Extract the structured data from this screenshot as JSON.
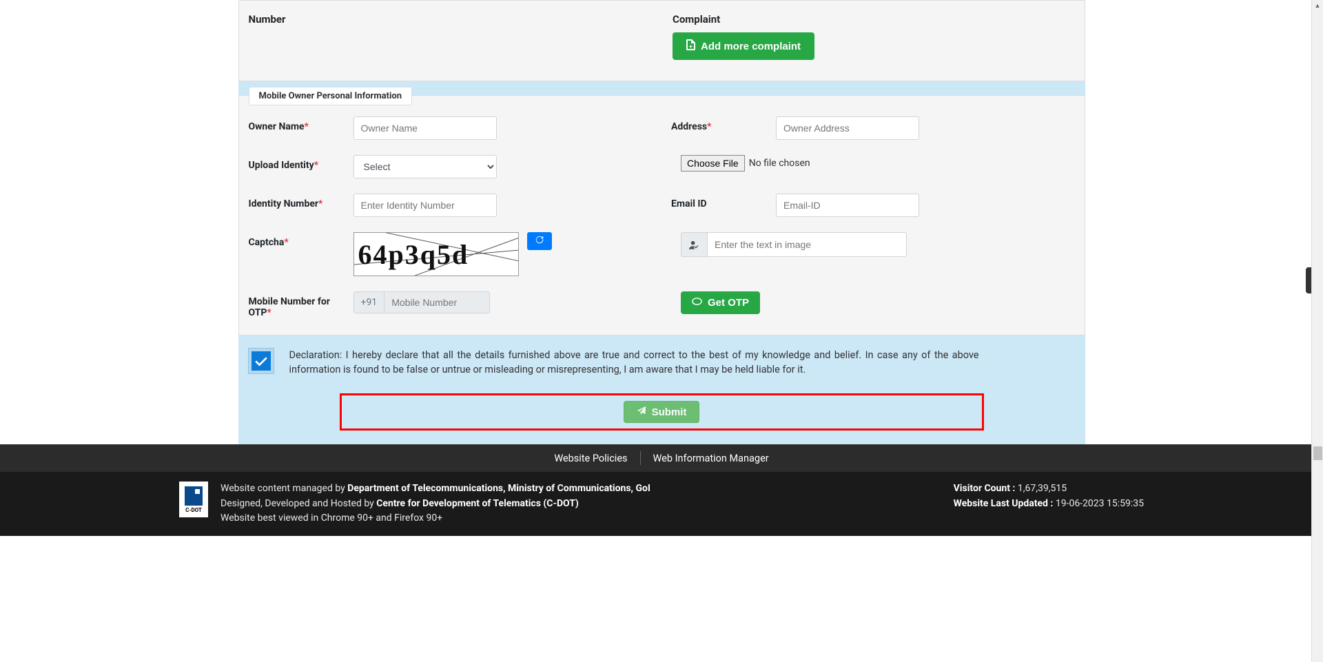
{
  "topSection": {
    "numberLabel": "Number",
    "complaintLabel": "Complaint",
    "addMoreBtn": "Add more complaint"
  },
  "personalInfo": {
    "legend": "Mobile Owner Personal Information",
    "ownerName": {
      "label": "Owner Name",
      "placeholder": "Owner Name"
    },
    "address": {
      "label": "Address",
      "placeholder": "Owner Address"
    },
    "uploadIdentity": {
      "label": "Upload Identity",
      "selected": "Select"
    },
    "fileChoose": {
      "btn": "Choose File",
      "status": "No file chosen"
    },
    "identityNumber": {
      "label": "Identity Number",
      "placeholder": "Enter Identity Number"
    },
    "emailId": {
      "label": "Email ID",
      "placeholder": "Email-ID"
    },
    "captcha": {
      "label": "Captcha",
      "imageText": "64p3q5d",
      "inputPlaceholder": "Enter the text in image"
    },
    "mobileOtp": {
      "label": "Mobile Number for OTP",
      "prefix": "+91",
      "placeholder": "Mobile Number"
    },
    "getOtpBtn": "Get OTP"
  },
  "declaration": {
    "text": "Declaration: I hereby declare that all the details furnished above are true and correct to the best of my knowledge and belief. In case any of the above information is found to be false or untrue or misleading or misrepresenting, I am aware that I may be held liable for it."
  },
  "submit": {
    "label": "Submit"
  },
  "footer": {
    "links": [
      "Website Policies",
      "Web Information Manager"
    ],
    "managedPrefix": "Website content managed by ",
    "managedBy": "Department of Telecommunications, Ministry of Communications, GoI",
    "hostedPrefix": "Designed, Developed and Hosted by ",
    "hostedBy": "Centre for Development of Telematics (C-DOT)",
    "browser": "Website best viewed in Chrome 90+ and Firefox 90+",
    "visitorLabel": "Visitor Count : ",
    "visitorCount": "1,67,39,515",
    "updatedLabel": "Website Last Updated : ",
    "updatedValue": "19-06-2023 15:59:35",
    "logoText": "C-DOT"
  }
}
